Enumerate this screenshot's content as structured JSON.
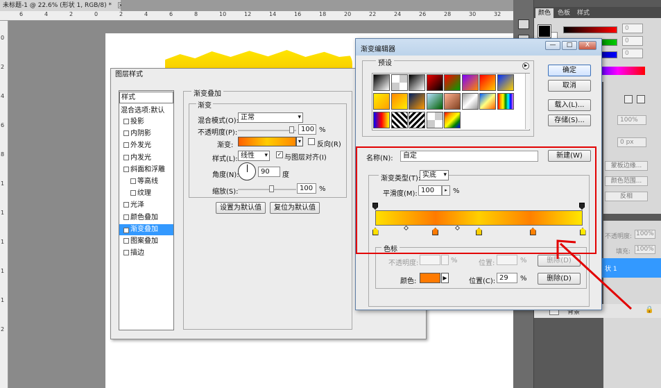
{
  "document": {
    "tab_title": "未标题-1 @ 22.6% (形状 1, RGB/8) *",
    "close_glyph": "×"
  },
  "rulers": {
    "top": [
      "6",
      "4",
      "2",
      "0",
      "2",
      "4",
      "6",
      "8",
      "10",
      "12",
      "14",
      "16",
      "18",
      "20",
      "22",
      "24",
      "26",
      "28",
      "30",
      "32"
    ],
    "left": [
      "0",
      "2",
      "4",
      "6",
      "8",
      "1",
      "1",
      "1",
      "1",
      "1",
      "2"
    ]
  },
  "color_panel": {
    "tabs": [
      "颜色",
      "色板",
      "样式"
    ],
    "values": [
      "0",
      "0",
      "0"
    ],
    "slider_colors": [
      "#ff0000",
      "#00cc00",
      "#0000ff"
    ]
  },
  "adjust_panel": {
    "percent": "100%",
    "px": "0 px",
    "buttons": [
      "蒙板边缘...",
      "颜色范围...",
      "反相"
    ]
  },
  "layers_panel": {
    "opacity_label": "不透明度:",
    "opacity_value": "100%",
    "fill_label": "填充:",
    "fill_value": "100%",
    "selected_layer": "状 1",
    "background_layer": "背景"
  },
  "layer_style": {
    "title": "图层样式",
    "styles_header": "样式",
    "blend_default": "混合选项:默认",
    "items": [
      {
        "label": "投影",
        "checked": false,
        "sub": false
      },
      {
        "label": "内阴影",
        "checked": false,
        "sub": false
      },
      {
        "label": "外发光",
        "checked": false,
        "sub": false
      },
      {
        "label": "内发光",
        "checked": false,
        "sub": false
      },
      {
        "label": "斜面和浮雕",
        "checked": false,
        "sub": false
      },
      {
        "label": "等高线",
        "checked": false,
        "sub": true
      },
      {
        "label": "纹理",
        "checked": false,
        "sub": true
      },
      {
        "label": "光泽",
        "checked": false,
        "sub": false
      },
      {
        "label": "颜色叠加",
        "checked": false,
        "sub": false
      },
      {
        "label": "渐变叠加",
        "checked": true,
        "sub": false
      },
      {
        "label": "图案叠加",
        "checked": false,
        "sub": false
      },
      {
        "label": "描边",
        "checked": false,
        "sub": false
      }
    ],
    "group_title": "渐变叠加",
    "sub_title": "渐变",
    "blend_mode_label": "混合模式(O):",
    "blend_mode_value": "正常",
    "opacity_label": "不透明度(P):",
    "opacity_value": "100",
    "percent": "%",
    "gradient_label": "渐变:",
    "reverse_label": "反向(R)",
    "reverse_checked": false,
    "style_label": "样式(L):",
    "style_value": "线性",
    "align_label": "与图层对齐(I)",
    "align_checked": true,
    "check_glyph": "✓",
    "angle_label": "角度(N):",
    "angle_value": "90",
    "degree": "度",
    "scale_label": "缩放(S):",
    "scale_value": "100",
    "default_btn": "设置为默认值",
    "reset_btn": "复位为默认值"
  },
  "gradient_editor": {
    "title": "渐变编辑器",
    "window_buttons": [
      "—",
      "□",
      "X"
    ],
    "presets_label": "预设",
    "presets_arrow": "▶",
    "ok": "确定",
    "cancel": "取消",
    "load": "载入(L)...",
    "save": "存储(S)...",
    "name_label": "名称(N):",
    "name_value": "自定",
    "new_btn": "新建(W)",
    "type_label": "渐变类型(T):",
    "type_value": "实底",
    "smooth_label": "平滑度(M):",
    "smooth_value": "100",
    "smooth_unit": "%",
    "stops_title": "色标",
    "opacity_label": "不透明度:",
    "position_label_dis": "位置:",
    "delete_dis": "删除(D)",
    "color_label": "颜色:",
    "position_label": "位置(C):",
    "position_value": "29",
    "percent": "%",
    "delete_btn": "删除(D)",
    "stop_colors": [
      "#ffe000",
      "#ff7a00",
      "#ffd000",
      "#ff8000",
      "#ffe800"
    ],
    "stop_positions": [
      0,
      0.29,
      0.5,
      0.76,
      1
    ],
    "preset_swatches": [
      "linear-gradient(135deg,#000,#fff)",
      "repeating-conic-gradient(#ccc 0 25%,#fff 0 50%)",
      "linear-gradient(135deg,#000,#fff)",
      "linear-gradient(135deg,#e00,#000)",
      "linear-gradient(135deg,#ff0000,#00a000)",
      "linear-gradient(135deg,#7a00ff,#ff8800)",
      "linear-gradient(135deg,#ff0000,#ffcc00)",
      "linear-gradient(135deg,#0030ff,#ffd000)",
      "linear-gradient(135deg,#ffee00,#ffa000)",
      "linear-gradient(135deg,#ff8800,#ffee00)",
      "linear-gradient(135deg,#002060,#ff9900)",
      "linear-gradient(135deg,#b4e0ff,#006000)",
      "linear-gradient(135deg,#ffb090,#804020)",
      "linear-gradient(135deg,#9a9a9a,#ffffff,#9a9a9a)",
      "linear-gradient(135deg,#0060ff,#ffff80,#ff6000)",
      "linear-gradient(90deg,red,orange,yellow,green,cyan,blue,violet)",
      "linear-gradient(90deg,#0000ff,#ff0000,#ffff00)",
      "repeating-linear-gradient(45deg,#000 0 3px,#fff 3px 6px)",
      "repeating-linear-gradient(-45deg,#000 0 3px,#fff 3px 6px)",
      "repeating-conic-gradient(#ccc 0 25%,#fff 0 50%)",
      "linear-gradient(135deg,red,orange,yellow,green,blue)"
    ]
  }
}
